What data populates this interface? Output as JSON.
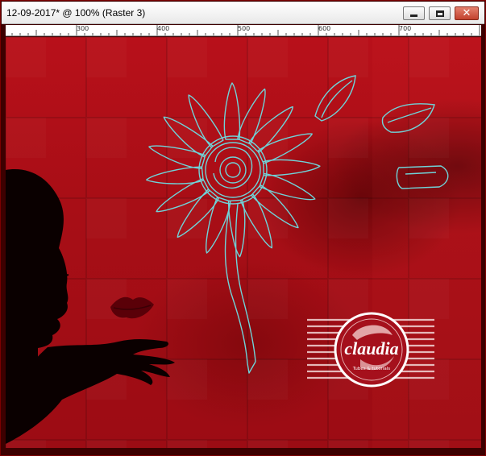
{
  "window": {
    "title": "12-09-2017* @ 100% (Raster 3)",
    "buttons": {
      "minimize_icon": "minimize-icon",
      "maximize_icon": "maximize-icon",
      "close_icon": "close-icon",
      "close_glyph": "✕"
    }
  },
  "ruler": {
    "labels": [
      "300",
      "400",
      "500",
      "600",
      "700"
    ]
  },
  "canvas": {
    "watermark": {
      "text": "claudia",
      "subtext": "Tubes & tutorials"
    }
  },
  "colors": {
    "background_red": "#b8101a",
    "selection_outline": "#6fd3d8",
    "title_bar": "#ffffff",
    "close_button": "#c2412e"
  }
}
